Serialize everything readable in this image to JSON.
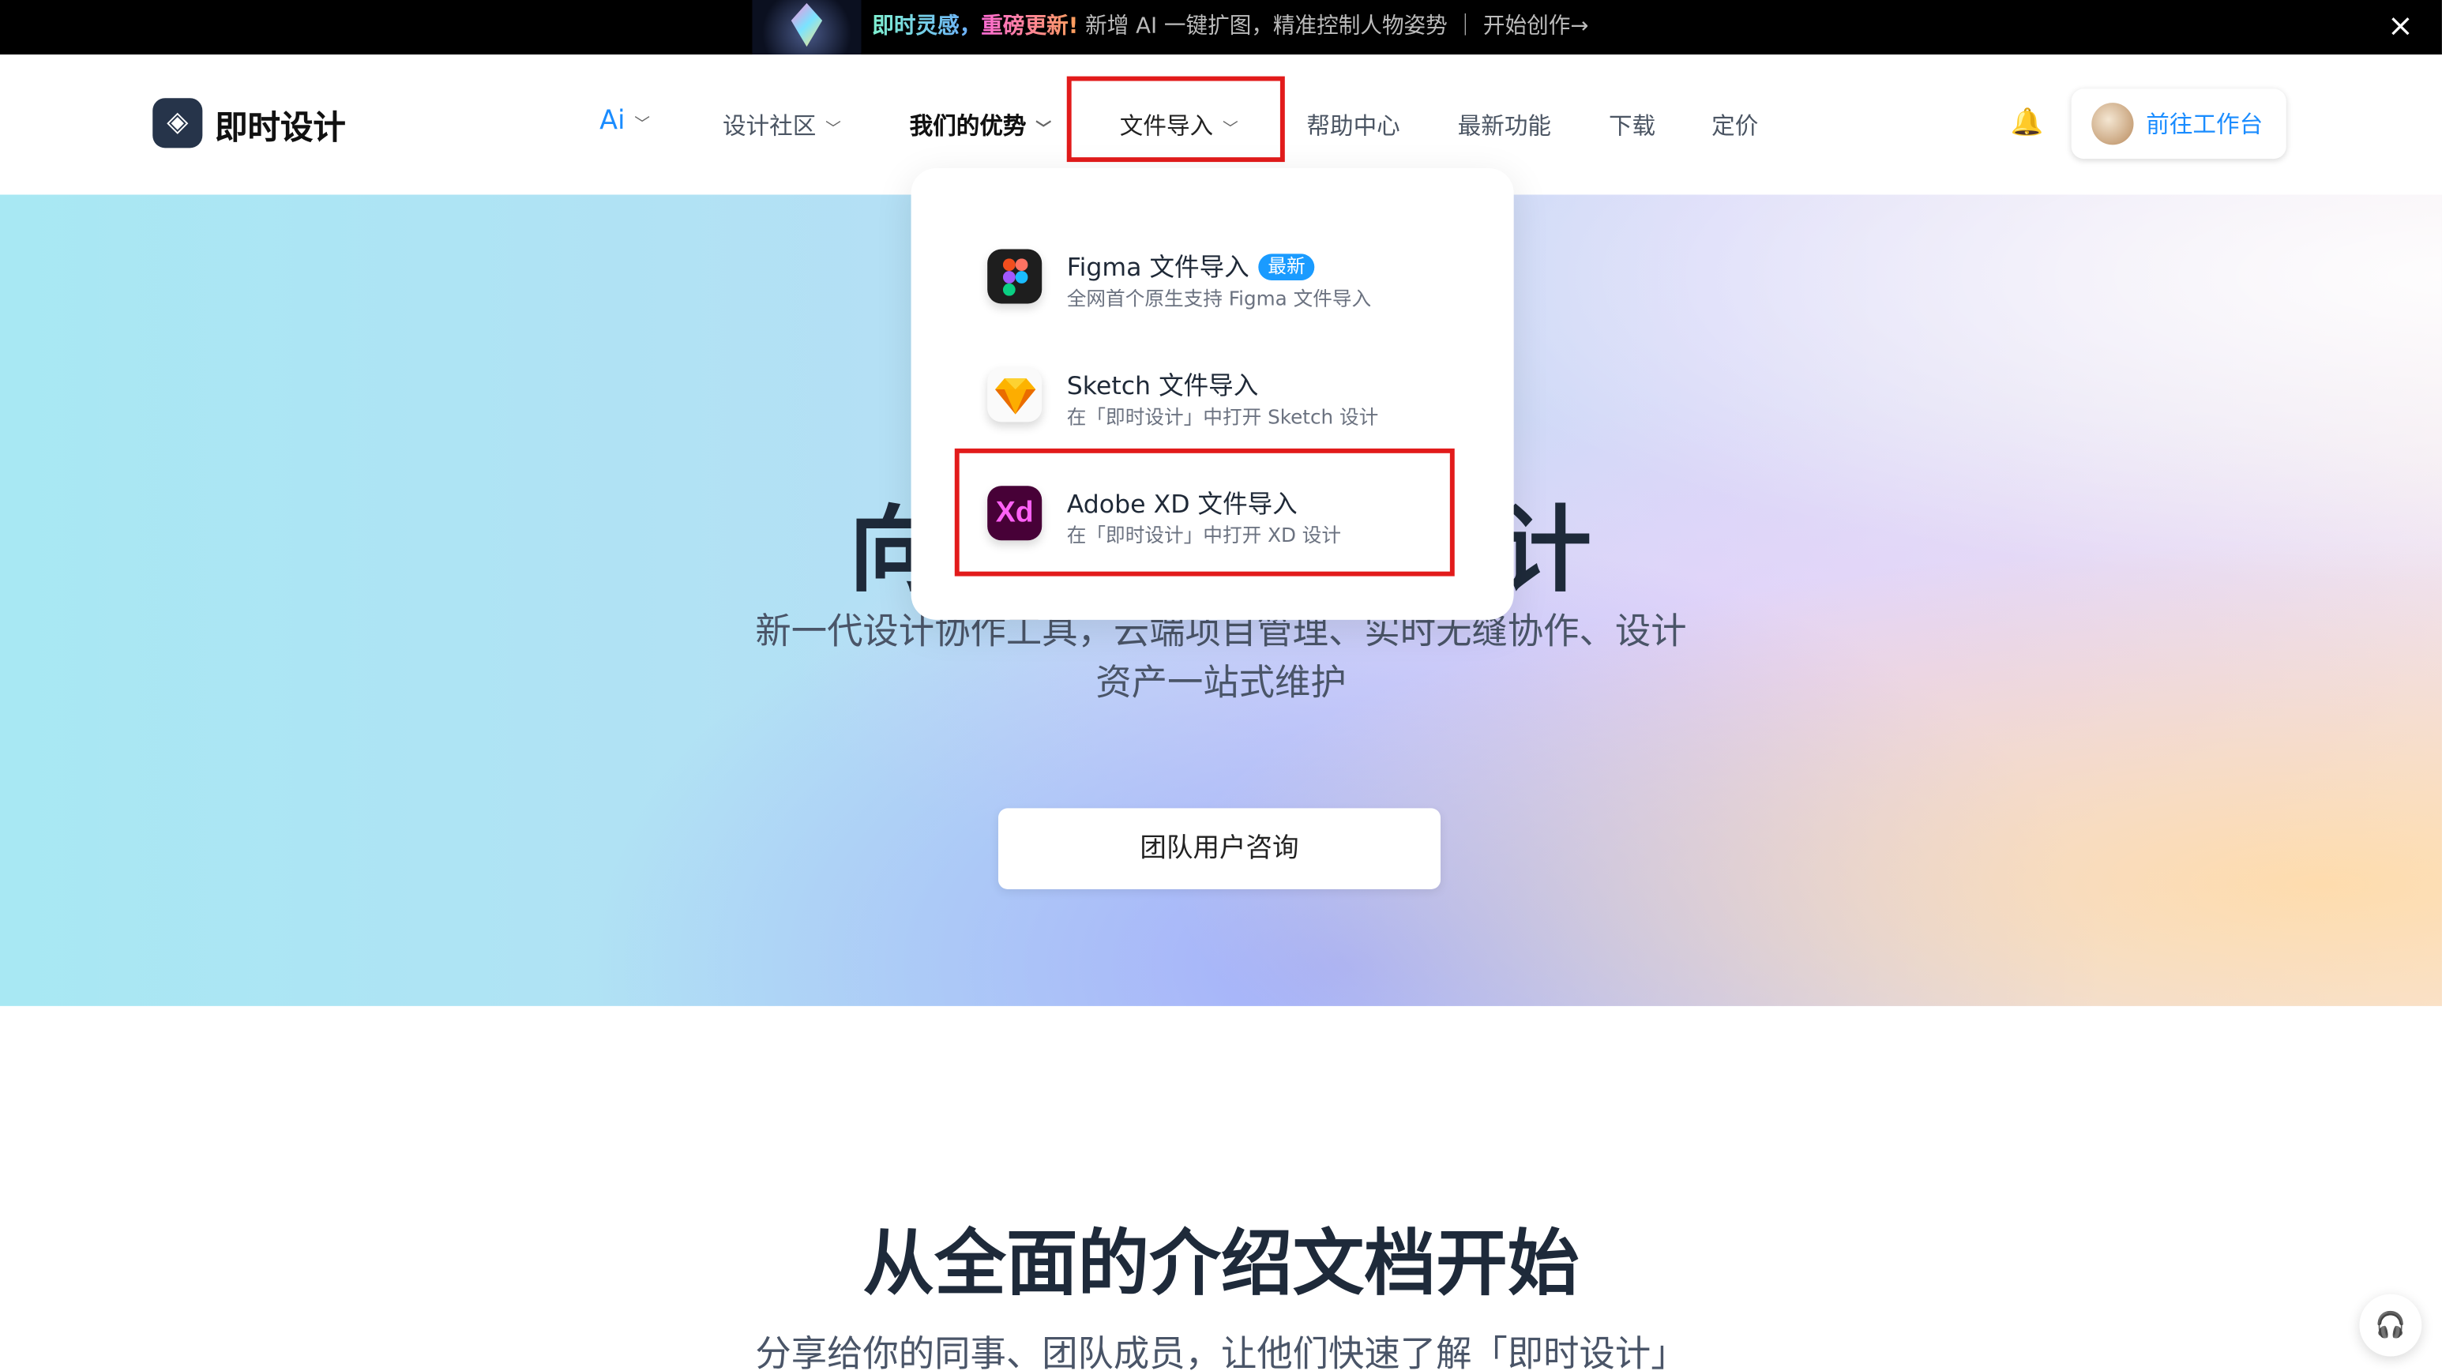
{
  "banner": {
    "highlight1": "即时灵感，",
    "highlight2": "重磅更新!",
    "text": " 新增 AI 一键扩图，精准控制人物姿势 ｜ 开始创作→",
    "close": "×"
  },
  "nav": {
    "logo": "即时设计",
    "items": [
      {
        "label": "Ai",
        "dropdown": true,
        "color": "#1a8cff"
      },
      {
        "label": "设计社区",
        "dropdown": true
      },
      {
        "label": "我们的优势",
        "dropdown": true,
        "bold": true
      },
      {
        "label": "文件导入",
        "dropdown": true,
        "active": true
      },
      {
        "label": "帮助中心"
      },
      {
        "label": "最新功能"
      },
      {
        "label": "下载"
      },
      {
        "label": "定价"
      }
    ],
    "workspace_button": "前往工作台"
  },
  "dropdown": {
    "items": [
      {
        "title": "Figma 文件导入",
        "badge": "最新",
        "subtitle": "全网首个原生支持 Figma 文件导入",
        "icon": "figma-icon"
      },
      {
        "title": "Sketch 文件导入",
        "subtitle": "在「即时设计」中打开 Sketch 设计",
        "icon": "sketch-icon"
      },
      {
        "title": "Adobe XD 文件导入",
        "subtitle": "在「即时设计」中打开 XD 设计",
        "icon": "adobe-xd-icon",
        "highlighted": true
      }
    ]
  },
  "hero": {
    "title_left": "向",
    "title_right": "计",
    "subtitle": "新一代设计协作工具，云端项目管理、实时无缝协作、设计资产一站式维护",
    "cta": "团队用户咨询"
  },
  "section": {
    "title": "从全面的介绍文档开始",
    "subtitle": "分享给你的同事、团队成员，让他们快速了解「即时设计」"
  },
  "colors": {
    "accent": "#1a8cff",
    "highlight_box": "#e21b1b"
  }
}
